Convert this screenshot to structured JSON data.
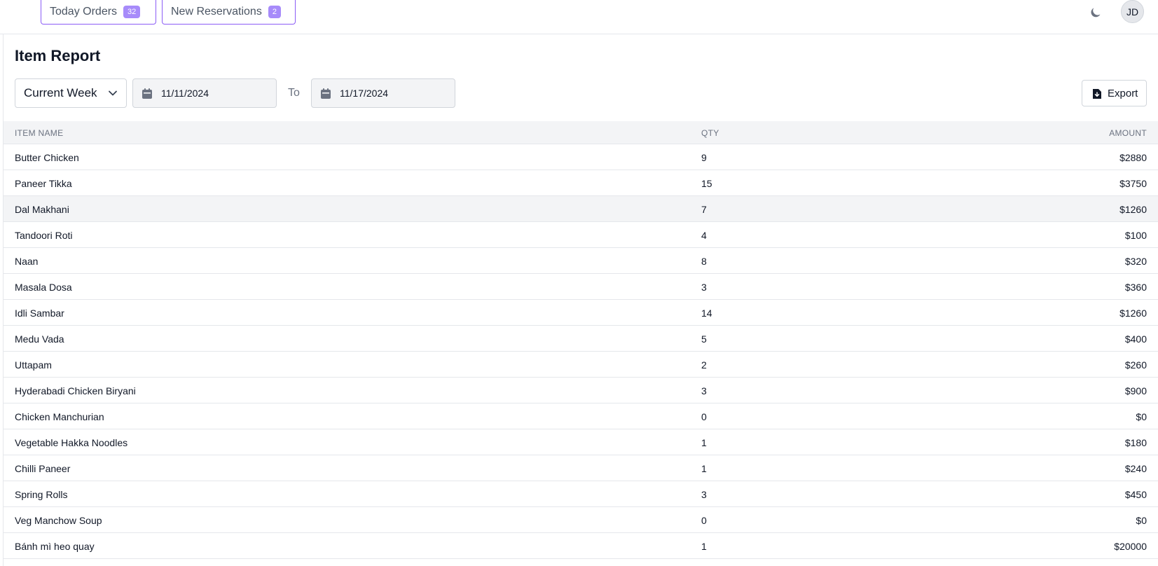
{
  "header": {
    "tabs": [
      {
        "label": "Today Orders",
        "badge": "32"
      },
      {
        "label": "New Reservations",
        "badge": "2"
      }
    ],
    "theme_toggle_icon": "moon-icon",
    "user_initials": "JD",
    "accent_color": "#8b5cf6"
  },
  "page": {
    "title": "Item Report"
  },
  "filters": {
    "range_selected": "Current Week",
    "from_date": "11/11/2024",
    "to_label": "To",
    "to_date": "11/17/2024",
    "export_label": "Export"
  },
  "table": {
    "columns": [
      "ITEM NAME",
      "QTY",
      "AMOUNT"
    ],
    "rows": [
      {
        "name": "Butter Chicken",
        "qty": "9",
        "amount": "$2880"
      },
      {
        "name": "Paneer Tikka",
        "qty": "15",
        "amount": "$3750"
      },
      {
        "name": "Dal Makhani",
        "qty": "7",
        "amount": "$1260"
      },
      {
        "name": "Tandoori Roti",
        "qty": "4",
        "amount": "$100"
      },
      {
        "name": "Naan",
        "qty": "8",
        "amount": "$320"
      },
      {
        "name": "Masala Dosa",
        "qty": "3",
        "amount": "$360"
      },
      {
        "name": "Idli Sambar",
        "qty": "14",
        "amount": "$1260"
      },
      {
        "name": "Medu Vada",
        "qty": "5",
        "amount": "$400"
      },
      {
        "name": "Uttapam",
        "qty": "2",
        "amount": "$260"
      },
      {
        "name": "Hyderabadi Chicken Biryani",
        "qty": "3",
        "amount": "$900"
      },
      {
        "name": "Chicken Manchurian",
        "qty": "0",
        "amount": "$0"
      },
      {
        "name": "Vegetable Hakka Noodles",
        "qty": "1",
        "amount": "$180"
      },
      {
        "name": "Chilli Paneer",
        "qty": "1",
        "amount": "$240"
      },
      {
        "name": "Spring Rolls",
        "qty": "3",
        "amount": "$450"
      },
      {
        "name": "Veg Manchow Soup",
        "qty": "0",
        "amount": "$0"
      },
      {
        "name": "Bánh mì heo quay",
        "qty": "1",
        "amount": "$20000"
      }
    ]
  }
}
